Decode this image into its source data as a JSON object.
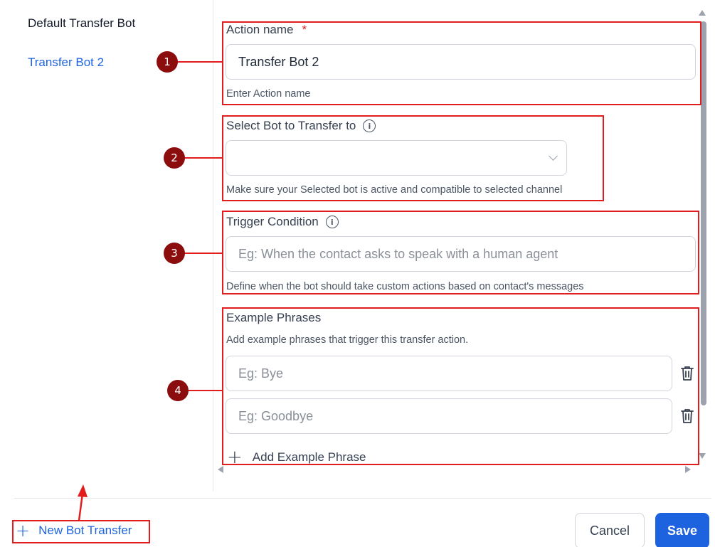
{
  "sidebar": {
    "items": [
      {
        "label": "Default Transfer Bot"
      },
      {
        "label": "Transfer Bot 2"
      }
    ]
  },
  "form": {
    "action_name": {
      "label": "Action name",
      "required_mark": "*",
      "value": "Transfer Bot 2",
      "help": "Enter Action name"
    },
    "select_bot": {
      "label": "Select Bot to Transfer to",
      "value": "",
      "help": "Make sure your Selected bot is active and compatible to selected channel"
    },
    "trigger_condition": {
      "label": "Trigger Condition",
      "placeholder": "Eg: When the contact asks to speak with a human agent",
      "help": "Define when the bot should take custom actions based on contact's messages"
    },
    "example_phrases": {
      "label": "Example Phrases",
      "help": "Add example phrases that trigger this transfer action.",
      "phrases": [
        {
          "placeholder": "Eg: Bye"
        },
        {
          "placeholder": "Eg: Goodbye"
        }
      ],
      "add_label": "Add Example Phrase"
    }
  },
  "footer": {
    "new_transfer_label": "New Bot Transfer",
    "cancel_label": "Cancel",
    "save_label": "Save"
  },
  "annotations": [
    "1",
    "2",
    "3",
    "4"
  ],
  "colors": {
    "accent": "#1d63e0",
    "annotation": "#e11d1d",
    "marker": "#8b0d0d"
  }
}
